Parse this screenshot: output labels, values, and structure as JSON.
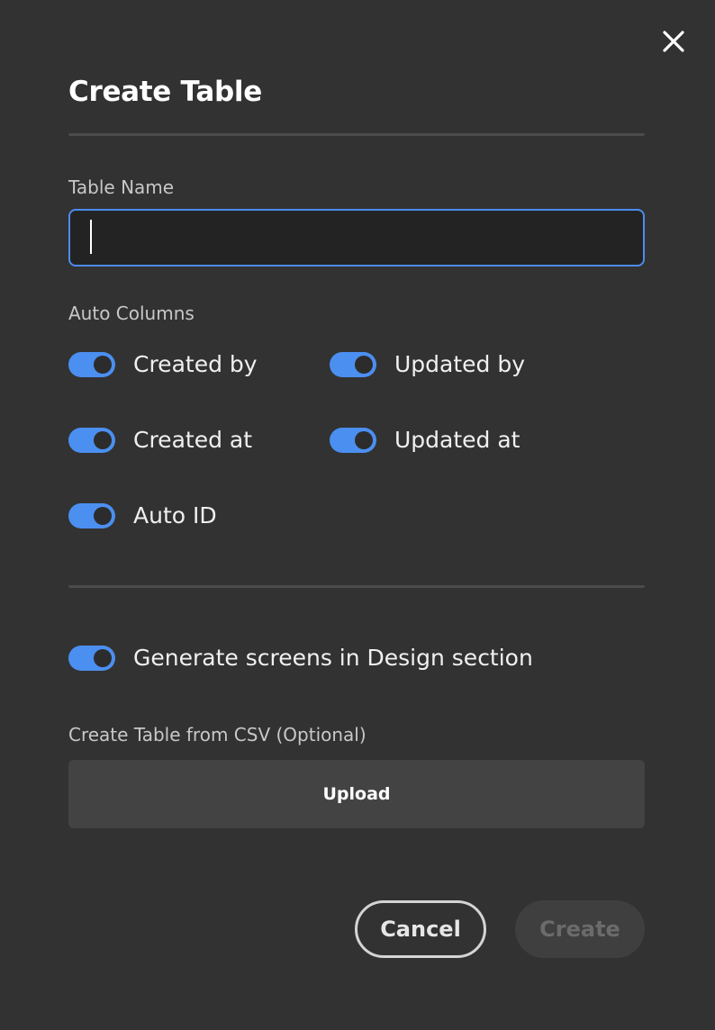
{
  "dialog": {
    "title": "Create Table",
    "close_icon": "close-icon"
  },
  "table_name": {
    "label": "Table Name",
    "value": "",
    "placeholder": ""
  },
  "auto_columns": {
    "label": "Auto Columns",
    "toggles": [
      {
        "label": "Created by",
        "on": true
      },
      {
        "label": "Updated by",
        "on": true
      },
      {
        "label": "Created at",
        "on": true
      },
      {
        "label": "Updated at",
        "on": true
      },
      {
        "label": "Auto ID",
        "on": true
      }
    ]
  },
  "generate_screens": {
    "label": "Generate screens in Design section",
    "on": true
  },
  "csv": {
    "label": "Create Table from CSV (Optional)",
    "upload_label": "Upload"
  },
  "footer": {
    "cancel_label": "Cancel",
    "create_label": "Create",
    "create_enabled": false
  },
  "colors": {
    "background": "#323232",
    "accent": "#4b8ff0",
    "input_background": "#232323",
    "divider": "#4b4b4b"
  }
}
